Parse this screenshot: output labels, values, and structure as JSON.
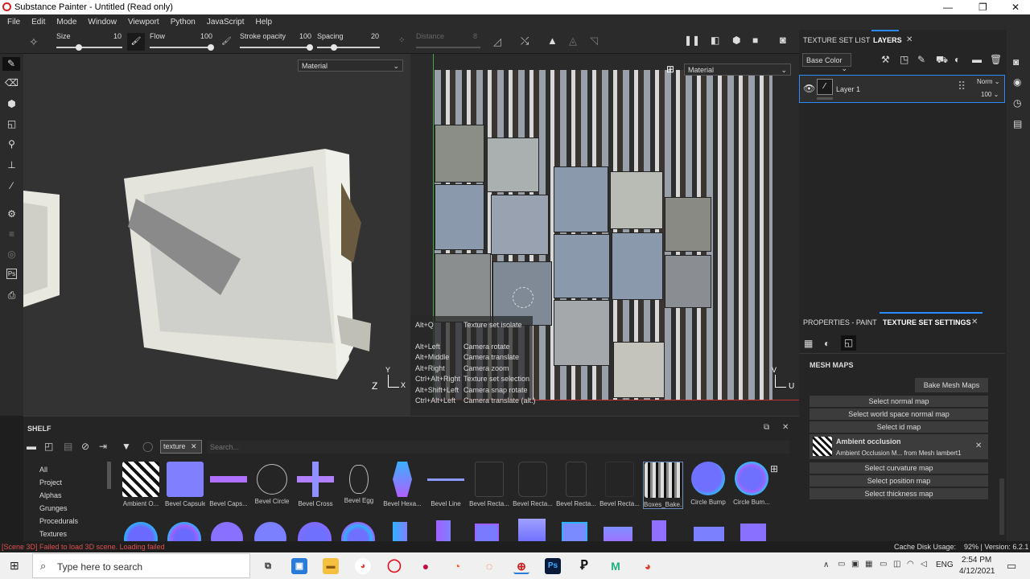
{
  "titlebar": {
    "title": "Substance Painter - Untitled (Read only)",
    "min": "—",
    "max": "❐",
    "close": "✕"
  },
  "menu": [
    "File",
    "Edit",
    "Mode",
    "Window",
    "Viewport",
    "Python",
    "JavaScript",
    "Help"
  ],
  "toolbar": {
    "size_label": "Size",
    "size_value": "10",
    "flow_label": "Flow",
    "flow_value": "100",
    "stroke_label": "Stroke opacity",
    "stroke_value": "100",
    "spacing_label": "Spacing",
    "spacing_value": "20",
    "distance_label": "Distance",
    "distance_value": "8"
  },
  "viewport3d": {
    "material_select": "Material",
    "axis_y": "Y",
    "axis_z": "Z",
    "axis_x": "X"
  },
  "viewport2d": {
    "material_select": "Material",
    "axis_v": "V",
    "axis_u": "U",
    "shortcuts": [
      {
        "key": "Alt+Q",
        "action": "Texture set isolate"
      },
      {
        "key": "Alt+Left",
        "action": "Camera rotate"
      },
      {
        "key": "Alt+Middle",
        "action": "Camera translate"
      },
      {
        "key": "Alt+Right",
        "action": "Camera zoom"
      },
      {
        "key": "Ctrl+Alt+Right",
        "action": "Texture set selection"
      },
      {
        "key": "Alt+Shift+Left",
        "action": "Camera snap rotate"
      },
      {
        "key": "Ctrl+Alt+Left",
        "action": "Camera translate (alt.)"
      }
    ]
  },
  "shelf": {
    "title": "SHELF",
    "filter_tag": "texture",
    "search_placeholder": "Search...",
    "categories": [
      "All",
      "Project",
      "Alphas",
      "Grunges",
      "Procedurals",
      "Textures"
    ],
    "items": [
      "Ambient O...",
      "Bevel Capsule",
      "Bevel Caps...",
      "Bevel Circle",
      "Bevel Cross",
      "Bevel Egg",
      "Bevel Hexa...",
      "Bevel Line",
      "Bevel Recta...",
      "Bevel Recta...",
      "Bevel Recta...",
      "Bevel Recta...",
      "Boxes_Bake...",
      "Circle Bump",
      "Circle Bum..."
    ]
  },
  "layers": {
    "tab_texture_set": "TEXTURE SET LIST",
    "tab_layers": "LAYERS",
    "channel_select": "Base Color",
    "layer_name": "Layer 1",
    "blend_mode": "Norm",
    "opacity": "100"
  },
  "properties": {
    "tab_paint": "PROPERTIES - PAINT",
    "tab_settings": "TEXTURE SET SETTINGS",
    "section": "MESH MAPS",
    "bake_button": "Bake Mesh Maps",
    "select_normal": "Select normal map",
    "select_world_normal": "Select world space normal map",
    "select_id": "Select id map",
    "ao_title": "Ambient occlusion",
    "ao_sub": "Ambient Occlusion M... from Mesh lambert1",
    "select_curvature": "Select curvature map",
    "select_position": "Select position map",
    "select_thickness": "Select thickness map"
  },
  "status": {
    "error": "[Scene 3D] Failed to load 3D scene. Loading failed",
    "cache": "Cache Disk Usage:    92% | Version: 6.2.1",
    "error_color": "#e05050"
  },
  "taskbar": {
    "search_placeholder": "Type here to search",
    "lang": "ENG",
    "time": "2:54 PM",
    "date": "4/12/2021"
  }
}
